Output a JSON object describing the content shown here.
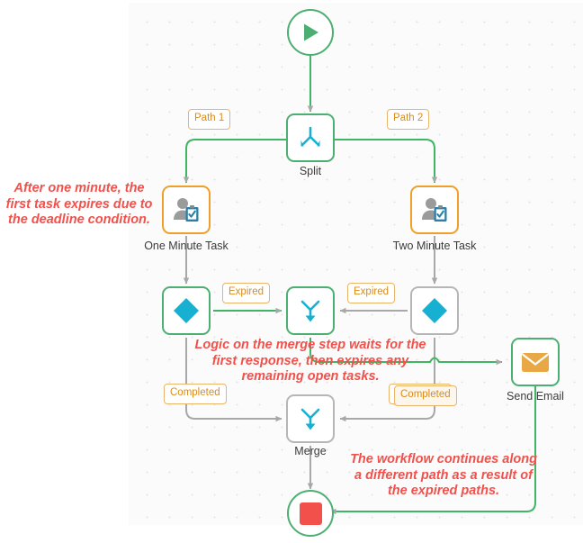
{
  "canvas": {
    "background_color": "#fbfbfb",
    "grid_dot_color": "#e3e3e3",
    "grid_spacing": 25
  },
  "palette": {
    "green": "#4caf72",
    "edge_green": "#3fb663",
    "edge_grey": "#b0b0b0",
    "orange": "#f0a02a",
    "cyan": "#17b0d0",
    "red": "#f2504b",
    "badge_text": "#d98b1d",
    "label_text": "#3b3b3b"
  },
  "nodes": [
    {
      "id": "start",
      "label": "",
      "icon": "play-icon",
      "shape": "circle",
      "border": "green"
    },
    {
      "id": "split",
      "label": "Split",
      "icon": "split-icon",
      "shape": "rounded-square",
      "border": "green"
    },
    {
      "id": "one-minute",
      "label": "One Minute Task",
      "icon": "user-task-icon",
      "shape": "rounded-square",
      "border": "orange"
    },
    {
      "id": "two-minute",
      "label": "Two Minute Task",
      "icon": "user-task-icon",
      "shape": "rounded-square",
      "border": "orange"
    },
    {
      "id": "gateway-left",
      "label": "",
      "icon": "diamond-gateway-icon",
      "shape": "rounded-square",
      "border": "green"
    },
    {
      "id": "gateway-right",
      "label": "",
      "icon": "diamond-gateway-icon",
      "shape": "rounded-square",
      "border": "grey"
    },
    {
      "id": "expire-merge",
      "label": "",
      "icon": "merge-icon",
      "shape": "rounded-square",
      "border": "green"
    },
    {
      "id": "merge",
      "label": "Merge",
      "icon": "merge-icon",
      "shape": "rounded-square",
      "border": "grey"
    },
    {
      "id": "send-email",
      "label": "Send Email",
      "icon": "envelope-icon",
      "shape": "rounded-square",
      "border": "green"
    },
    {
      "id": "end",
      "label": "",
      "icon": "stop-icon",
      "shape": "circle",
      "border": "green"
    }
  ],
  "edge_labels": [
    {
      "id": "path-1",
      "text": "Path 1"
    },
    {
      "id": "path-2",
      "text": "Path 2"
    },
    {
      "id": "expired-left",
      "text": "Expired"
    },
    {
      "id": "expired-right",
      "text": "Expired"
    },
    {
      "id": "completed-left",
      "text": "Completed"
    },
    {
      "id": "completed-right",
      "text": "Completed"
    },
    {
      "id": "completed-email",
      "text": "Completed"
    }
  ],
  "annotations": [
    {
      "id": "annotation-deadline",
      "text": "After one minute, the first task expires due to the deadline condition."
    },
    {
      "id": "annotation-merge-logic",
      "text": "Logic on the merge step waits for the first response, then expires any remaining open tasks."
    },
    {
      "id": "annotation-continue",
      "text": "The workflow continues along a different path as a result of the expired paths."
    }
  ]
}
